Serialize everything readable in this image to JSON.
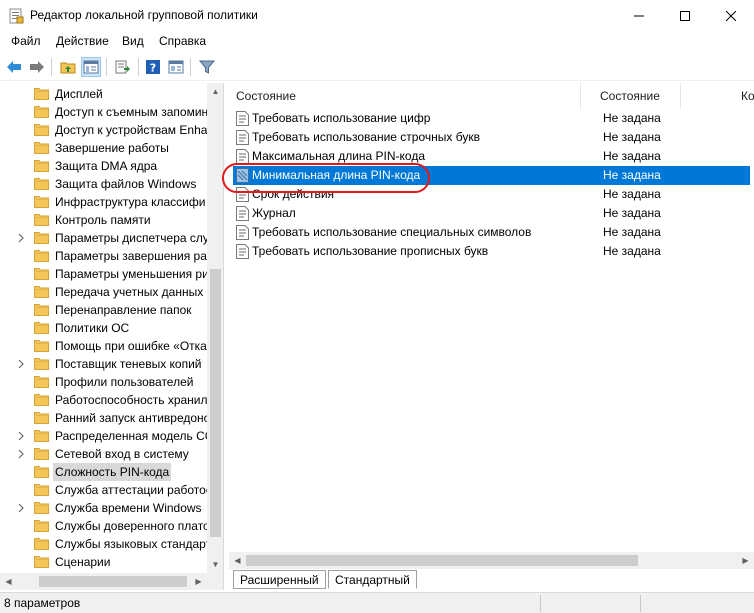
{
  "window": {
    "title": "Редактор локальной групповой политики",
    "minimize_icon": "minimize-icon",
    "maximize_icon": "maximize-icon",
    "close_icon": "close-icon"
  },
  "menu": {
    "items": [
      {
        "label": "Файл"
      },
      {
        "label": "Действие"
      },
      {
        "label": "Вид"
      },
      {
        "label": "Справка"
      }
    ]
  },
  "toolbar": {
    "buttons": [
      "back-icon",
      "forward-icon",
      "up-folder-icon",
      "show-hide-tree-icon",
      "export-list-icon",
      "help-icon",
      "properties-icon",
      "filter-icon"
    ]
  },
  "tree": {
    "items": [
      {
        "label": "Дисплей",
        "expandable": false,
        "selected": false
      },
      {
        "label": "Доступ к съемным запомин",
        "expandable": false,
        "selected": false
      },
      {
        "label": "Доступ к устройствам Enha",
        "expandable": false,
        "selected": false
      },
      {
        "label": "Завершение работы",
        "expandable": false,
        "selected": false
      },
      {
        "label": "Защита DMA ядра",
        "expandable": false,
        "selected": false
      },
      {
        "label": "Защита файлов Windows",
        "expandable": false,
        "selected": false
      },
      {
        "label": "Инфраструктура классифи",
        "expandable": false,
        "selected": false
      },
      {
        "label": "Контроль памяти",
        "expandable": false,
        "selected": false
      },
      {
        "label": "Параметры диспетчера слу",
        "expandable": true,
        "selected": false
      },
      {
        "label": "Параметры завершения ра",
        "expandable": false,
        "selected": false
      },
      {
        "label": "Параметры уменьшения ри",
        "expandable": false,
        "selected": false
      },
      {
        "label": "Передача учетных данных",
        "expandable": false,
        "selected": false
      },
      {
        "label": "Перенаправление папок",
        "expandable": false,
        "selected": false
      },
      {
        "label": "Политики ОС",
        "expandable": false,
        "selected": false
      },
      {
        "label": "Помощь при ошибке «Отка",
        "expandable": false,
        "selected": false
      },
      {
        "label": "Поставщик теневых копий",
        "expandable": true,
        "selected": false
      },
      {
        "label": "Профили пользователей",
        "expandable": false,
        "selected": false
      },
      {
        "label": "Работоспособность хранил",
        "expandable": false,
        "selected": false
      },
      {
        "label": "Ранний запуск антивредонс",
        "expandable": false,
        "selected": false
      },
      {
        "label": "Распределенная модель СС",
        "expandable": true,
        "selected": false
      },
      {
        "label": "Сетевой вход в систему",
        "expandable": true,
        "selected": false
      },
      {
        "label": "Сложность PIN-кода",
        "expandable": false,
        "selected": true
      },
      {
        "label": "Служба аттестации работос",
        "expandable": false,
        "selected": false
      },
      {
        "label": "Служба времени Windows",
        "expandable": true,
        "selected": false
      },
      {
        "label": "Службы доверенного плато",
        "expandable": false,
        "selected": false
      },
      {
        "label": "Службы языковых стандарт",
        "expandable": false,
        "selected": false
      },
      {
        "label": "Сценарии",
        "expandable": false,
        "selected": false
      }
    ]
  },
  "list": {
    "headers": {
      "name": "Состояние",
      "state": "Состояние",
      "comment": "Ко"
    },
    "rows": [
      {
        "name": "Требовать использование цифр",
        "state": "Не задана",
        "selected": false
      },
      {
        "name": "Требовать использование строчных букв",
        "state": "Не задана",
        "selected": false
      },
      {
        "name": "Максимальная длина PIN-кода",
        "state": "Не задана",
        "selected": false
      },
      {
        "name": "Минимальная длина PIN-кода",
        "state": "Не задана",
        "selected": true
      },
      {
        "name": "Срок действия",
        "state": "Не задана",
        "selected": false
      },
      {
        "name": "Журнал",
        "state": "Не задана",
        "selected": false
      },
      {
        "name": "Требовать использование специальных символов",
        "state": "Не задана",
        "selected": false
      },
      {
        "name": "Требовать использование прописных букв",
        "state": "Не задана",
        "selected": false
      }
    ]
  },
  "tabs": [
    {
      "label": "Расширенный",
      "active": false
    },
    {
      "label": "Стандартный",
      "active": true
    }
  ],
  "status": {
    "text": "8 параметров"
  },
  "colors": {
    "selection": "#0078d7",
    "highlight_ring": "#e0191c",
    "folder": "#f4c657"
  }
}
